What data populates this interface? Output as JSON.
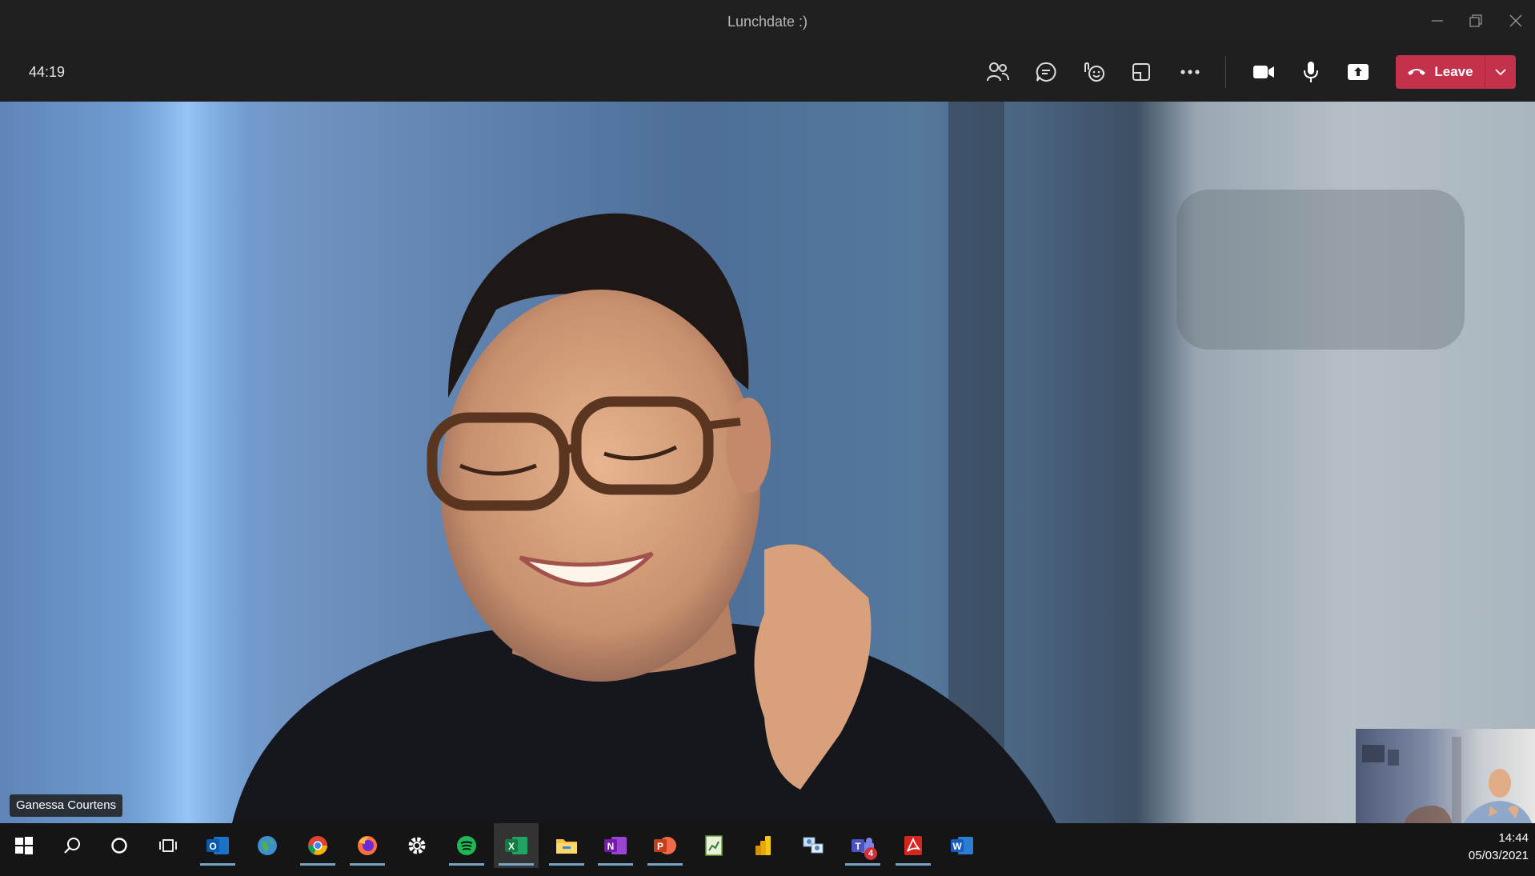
{
  "window": {
    "title": "Lunchdate :)",
    "controls": [
      "minimize-icon",
      "restore-icon",
      "close-icon"
    ]
  },
  "toolbar": {
    "timer": "44:19",
    "buttons": [
      "people-icon",
      "chat-icon",
      "reactions-icon",
      "breakout-rooms-icon",
      "more-options-icon",
      "camera-icon",
      "microphone-icon",
      "share-screen-icon"
    ],
    "leave_label": "Leave",
    "leave_color": "#c4314b"
  },
  "video": {
    "participant_name": "Ganessa Courtens"
  },
  "taskbar": {
    "apps": [
      "windows-start-icon",
      "search-icon",
      "cortana-icon",
      "task-view-icon",
      "outlook-icon",
      "browser-globe-icon",
      "chrome-icon",
      "firefox-icon",
      "settings-icon",
      "spotify-icon",
      "excel-icon",
      "file-explorer-icon",
      "onenote-icon",
      "powerpoint-icon",
      "project-icon",
      "power-bi-icon",
      "network-icon",
      "teams-icon",
      "acrobat-icon",
      "word-icon"
    ],
    "teams_badge": "4",
    "time": "14:44",
    "date": "05/03/2021"
  }
}
